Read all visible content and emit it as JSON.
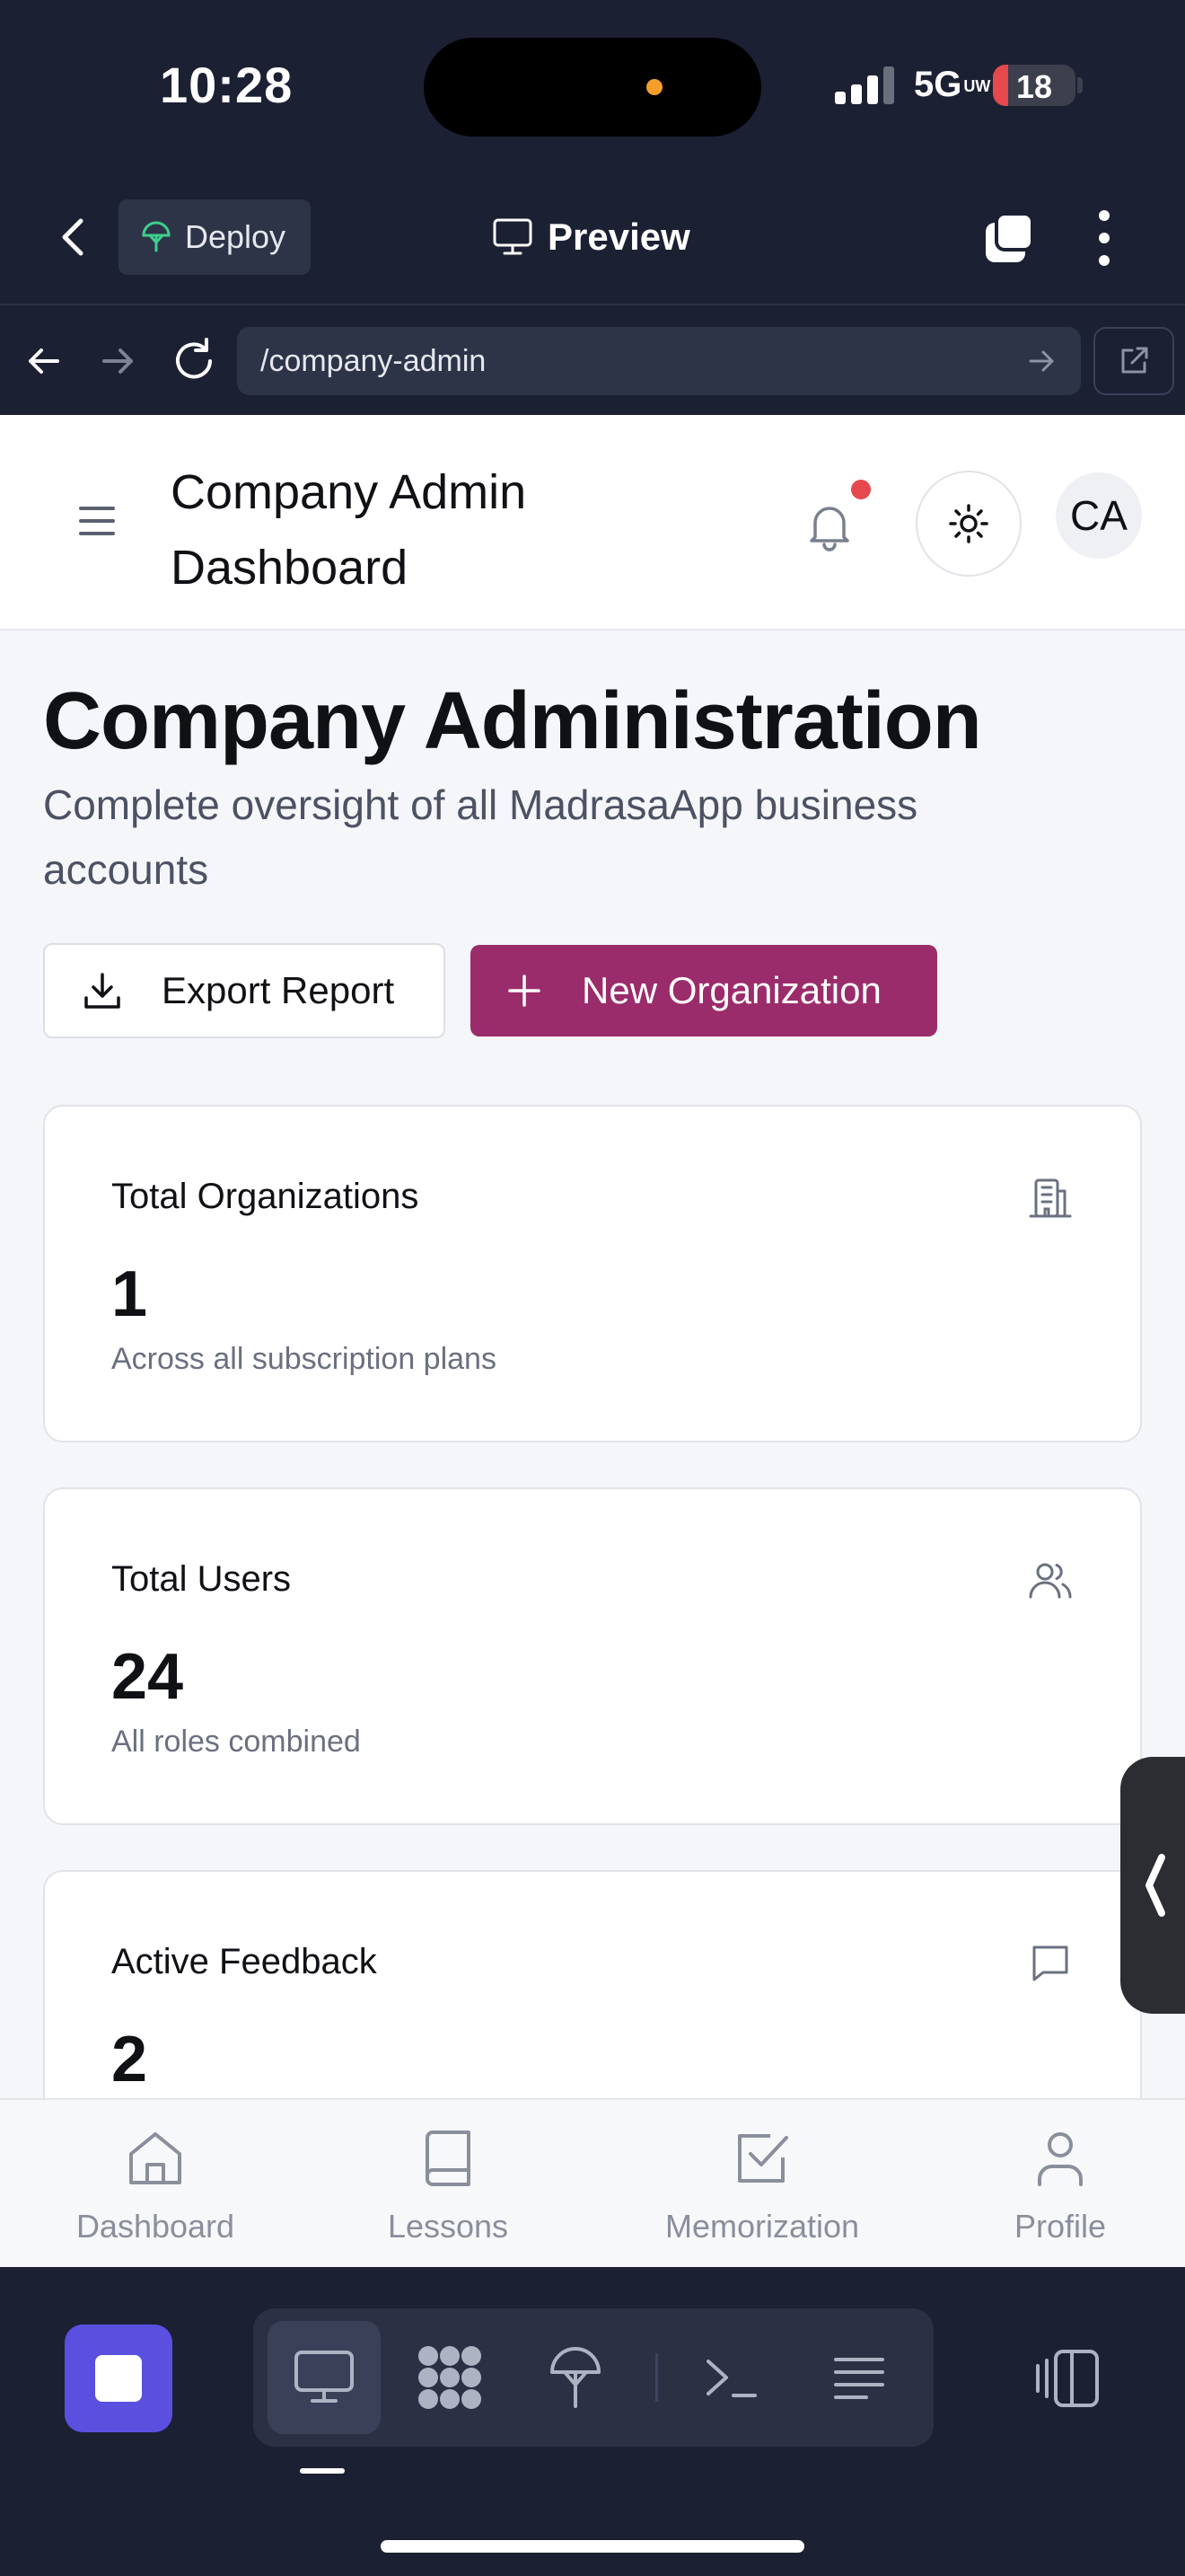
{
  "status_bar": {
    "time": "10:28",
    "network": "5G",
    "network_sub": "UW",
    "battery": "18",
    "battery_level": 0.18
  },
  "toolbar": {
    "deploy_label": "Deploy",
    "preview_label": "Preview"
  },
  "browser": {
    "url": "/company-admin"
  },
  "app": {
    "header_title": "Company Admin Dashboard",
    "avatar_initials": "CA",
    "page_title": "Company Administration",
    "page_subtitle": "Complete oversight of all MadrasaApp business accounts",
    "export_label": "Export Report",
    "new_org_label": "New Organization",
    "stats": [
      {
        "label": "Total Organizations",
        "value": "1",
        "description": "Across all subscription plans",
        "icon": "building-icon"
      },
      {
        "label": "Total Users",
        "value": "24",
        "description": "All roles combined",
        "icon": "users-icon"
      },
      {
        "label": "Active Feedback",
        "value": "2",
        "description": "",
        "icon": "message-icon"
      }
    ],
    "bottom_nav": [
      {
        "label": "Dashboard",
        "icon": "home-icon"
      },
      {
        "label": "Lessons",
        "icon": "book-icon"
      },
      {
        "label": "Memorization",
        "icon": "checkbox-icon"
      },
      {
        "label": "Profile",
        "icon": "user-icon"
      }
    ]
  },
  "colors": {
    "chrome_bg": "#1c2033",
    "brand_primary": "#9b2c6b",
    "stop_button": "#5b4fe0",
    "notification_dot": "#e5484d",
    "app_bg": "#f5f6f9"
  }
}
